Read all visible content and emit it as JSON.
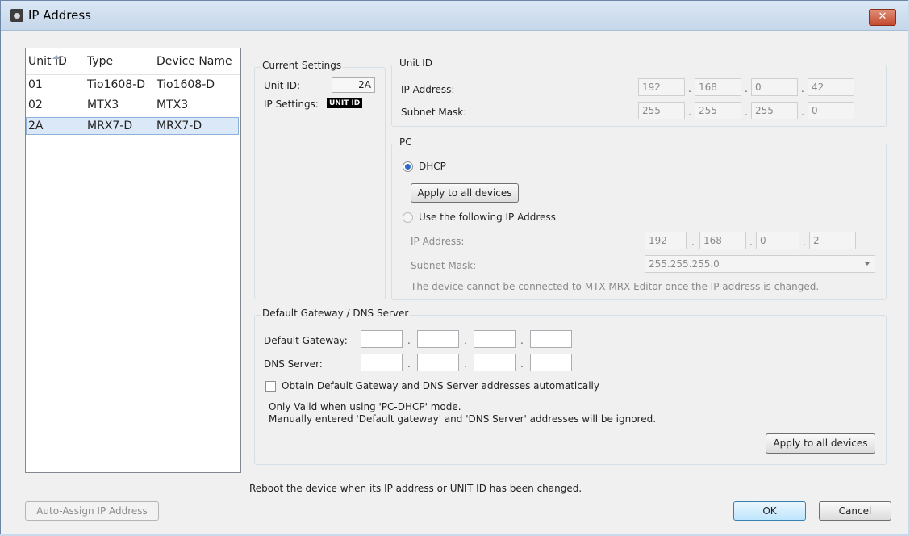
{
  "window": {
    "title": "IP Address",
    "close_label": "✕"
  },
  "device_list": {
    "columns": [
      "Unit ID",
      "Type",
      "Device Name"
    ],
    "rows": [
      {
        "unit_id": "01",
        "type": "Tio1608-D",
        "name": "Tio1608-D"
      },
      {
        "unit_id": "02",
        "type": "MTX3",
        "name": "MTX3"
      },
      {
        "unit_id": "2A",
        "type": "MRX7-D",
        "name": "MRX7-D"
      }
    ],
    "selected_index": 2
  },
  "current_settings": {
    "title": "Current Settings",
    "unit_id_label": "Unit ID:",
    "unit_id_value": "2A",
    "ip_settings_label": "IP Settings:",
    "ip_settings_badge": "UNIT ID"
  },
  "unit_id_group": {
    "title": "Unit ID",
    "ip_label": "IP Address:",
    "ip": [
      "192",
      "168",
      "0",
      "42"
    ],
    "subnet_label": "Subnet Mask:",
    "subnet": [
      "255",
      "255",
      "255",
      "0"
    ]
  },
  "pc_group": {
    "title": "PC",
    "dhcp_label": "DHCP",
    "dhcp_selected": true,
    "apply_label": "Apply to all devices",
    "use_following_label": "Use the following IP Address",
    "ip_label": "IP Address:",
    "ip": [
      "192",
      "168",
      "0",
      "2"
    ],
    "subnet_label": "Subnet Mask:",
    "subnet_value": "255.255.255.0",
    "note": "The device cannot be connected to MTX-MRX Editor once the IP address is changed."
  },
  "gateway_group": {
    "title": "Default Gateway / DNS Server",
    "gateway_label": "Default Gateway:",
    "dns_label": "DNS Server:",
    "auto_label": "Obtain Default Gateway and DNS Server addresses automatically",
    "auto_checked": false,
    "note_line1": "Only Valid when using 'PC-DHCP' mode.",
    "note_line2": "Manually entered 'Default gateway' and 'DNS Server' addresses will be ignored.",
    "apply_label": "Apply to all devices"
  },
  "footer": {
    "reboot_note": "Reboot the device when its IP address or UNIT ID has been changed.",
    "auto_assign_label": "Auto-Assign IP Address",
    "ok_label": "OK",
    "cancel_label": "Cancel"
  },
  "colors": {
    "accent": "#3c7fb1",
    "selection": "#dbe8f7",
    "close": "#c44a2f"
  }
}
